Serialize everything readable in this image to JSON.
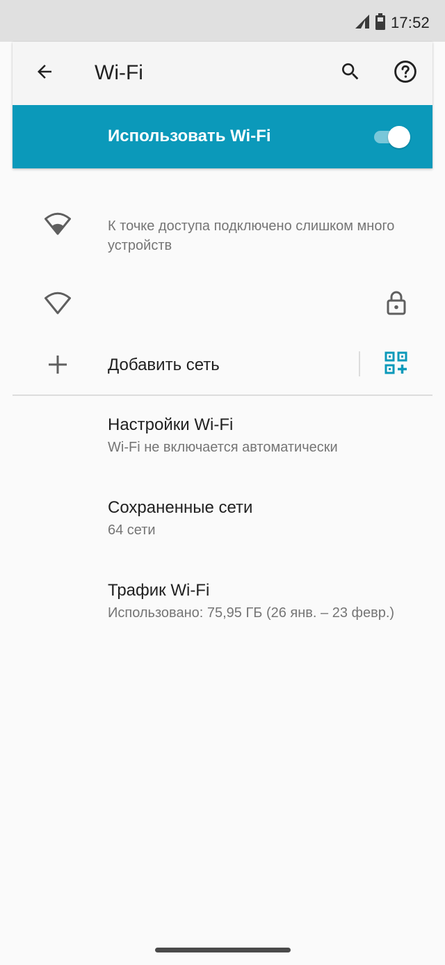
{
  "status_bar": {
    "time": "17:52",
    "icons": [
      "cell-signal-icon",
      "battery-icon"
    ]
  },
  "toolbar": {
    "title": "Wi-Fi",
    "back_icon": "arrow-back-icon",
    "search_icon": "search-icon",
    "help_icon": "help-icon"
  },
  "wifi_switch": {
    "label": "Использовать Wi-Fi",
    "enabled": true,
    "color": "#0b99ba"
  },
  "networks": [
    {
      "icon": "wifi-signal-icon",
      "status": "К точке доступа подключено слишком много устройств"
    },
    {
      "icon": "wifi-icon",
      "name": "",
      "secured": true,
      "lock_icon": "lock-icon"
    }
  ],
  "add_network": {
    "label": "Добавить сеть",
    "plus_icon": "plus-icon",
    "qr_icon": "qr-scan-icon"
  },
  "settings": [
    {
      "title": "Настройки Wi-Fi",
      "subtitle": "Wi-Fi не включается автоматически"
    },
    {
      "title": "Сохраненные сети",
      "subtitle": "64 сети"
    },
    {
      "title": "Трафик Wi-Fi",
      "subtitle": "Использовано: 75,95 ГБ (26 янв. – 23 февр.)"
    }
  ]
}
